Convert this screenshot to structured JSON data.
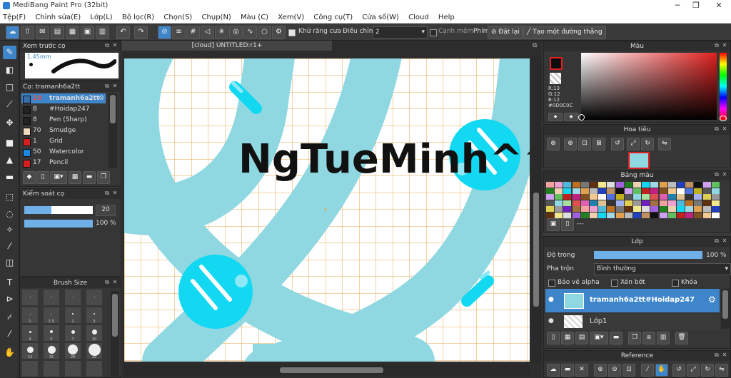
{
  "window": {
    "title": "MediBang Paint Pro (32bit)"
  },
  "menu": [
    "Tệp(F)",
    "Chỉnh sửa(E)",
    "Lớp(L)",
    "Bộ lọc(R)",
    "Chọn(S)",
    "Chụp(N)",
    "Màu (C)",
    "Xem(V)",
    "Công cụ(T)",
    "Cửa số(W)",
    "Cloud",
    "Help"
  ],
  "toolbar": {
    "antialias_label": "Khử răng cưa",
    "correction_label": "Điều chỉnh",
    "correction_value": "2",
    "soft_edge_label": "Cạnh mềm",
    "key_label": "Phím",
    "reset_label": "Đặt lại",
    "straight_line_label": "Tạo một đường thẳng"
  },
  "brush_preview": {
    "title": "Xem trước cọ",
    "size": "1.45mm"
  },
  "brush_list": {
    "title": "Cọ: tramanh6a2tt",
    "items": [
      {
        "size": "20",
        "name": "tramanh6a2tt",
        "color": "#3b6ea8"
      },
      {
        "size": "8",
        "name": "#Hoidap247",
        "color": "#222222"
      },
      {
        "size": "8",
        "name": "Pen (Sharp)",
        "color": "#222222"
      },
      {
        "size": "70",
        "name": "Smudge",
        "color": "#f3d9c0"
      },
      {
        "size": "1",
        "name": "Grid",
        "color": "#d42020"
      },
      {
        "size": "50",
        "name": "Watercolor",
        "color": "#1e88e5"
      },
      {
        "size": "17",
        "name": "Pencil",
        "color": "#d42020"
      }
    ]
  },
  "brush_control": {
    "title": "Kiểm soát cọ",
    "size_value": "20",
    "opacity_value": "100 %",
    "size_fraction": 0.4,
    "opacity_fraction": 1.0
  },
  "brush_size": {
    "title": "Brush Size",
    "labels": [
      "1",
      "1.5",
      "2",
      "3",
      "4",
      "5",
      "7",
      "10",
      "12",
      "15",
      "20",
      "25"
    ]
  },
  "document": {
    "tab": "[cloud] UNTITLED:r1+"
  },
  "canvas": {
    "text": "NgTueMinh^^"
  },
  "color_panel": {
    "title": "Màu",
    "r": "R:13",
    "g": "G:12",
    "b": "B:12",
    "hex": "#0D0C0C"
  },
  "navigator": {
    "title": "Hoa tiêu"
  },
  "palette": {
    "title": "Bảng màu",
    "extra": "---"
  },
  "layer_panel": {
    "title": "Lớp",
    "opacity_label": "Độ trong",
    "opacity_value": "100 %",
    "opacity_fraction": 1.0,
    "blend_label": "Pha trộn",
    "blend_value": "Bình thường",
    "protect_alpha": "Bảo vệ alpha",
    "clipping": "Xén bớt",
    "lock": "Khóa",
    "layers": [
      {
        "name": "tramanh6a2tt#Hoidap247",
        "selected": true
      },
      {
        "name": "Lớp1",
        "selected": false
      }
    ]
  },
  "reference": {
    "title": "Reference"
  },
  "colors": {
    "accent": "#3e86c9",
    "canvas_bg": "#ffffff",
    "cyan": "#12d8f2",
    "light_blue": "#8fd8e2",
    "grid": "#e9a44c"
  }
}
